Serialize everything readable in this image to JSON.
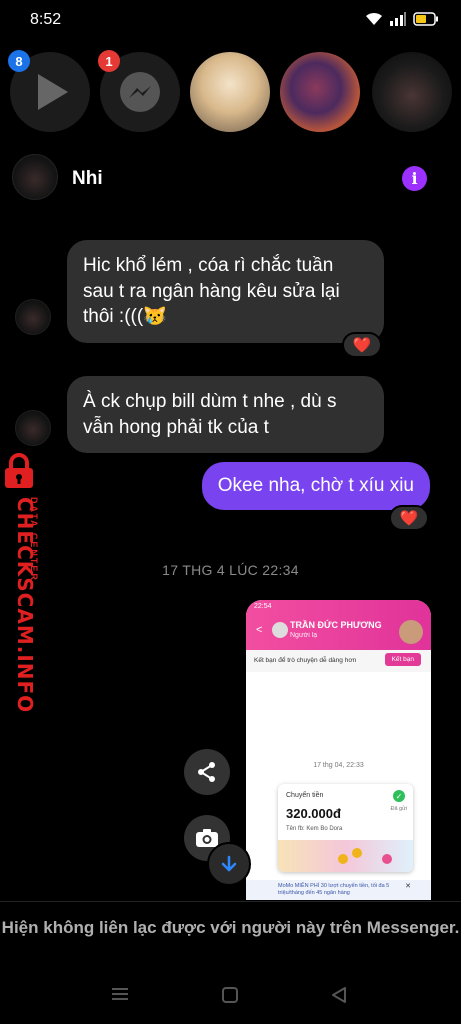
{
  "status_bar": {
    "time": "8:52"
  },
  "chat_heads": [
    {
      "name": "video-chat-head",
      "badge": "8",
      "badge_color": "#1a73e8"
    },
    {
      "name": "messenger-chat-head",
      "badge": "1",
      "badge_color": "#e53935"
    },
    {
      "name": "contact-chat-head-1"
    },
    {
      "name": "contact-chat-head-2"
    },
    {
      "name": "contact-chat-head-3"
    }
  ],
  "chat": {
    "contact_name": "Nhi",
    "info_icon": "i",
    "messages": [
      {
        "text": "Hic khổ lém , cóa rì chắc tuần sau t ra ngân hàng kêu sửa lại thôi :(((😿",
        "reaction": "❤️"
      },
      {
        "text": "À ck chụp bill dùm t nhe , dù s vẫn hong phải tk của t"
      },
      {
        "text": "Okee nha, chờ t xíu xiu",
        "reaction": "❤️"
      }
    ],
    "timestamp": "17 THG 4 LÚC 22:34",
    "shared_image": {
      "time": "22:54",
      "name": "TRẦN ĐỨC PHƯƠNG",
      "subtitle": "Người lạ",
      "strip_text": "Kết bạn để trò chuyện dễ dàng hơn",
      "strip_button": "Kết bạn",
      "date": "17 thg 04, 22:33",
      "card_title": "Chuyển tiền",
      "amount": "320.000đ",
      "account": "Tên fb: Kem Bo Dora",
      "status": "Đã gửi",
      "promo": "MoMo MIỄN PHÍ 30 lượt chuyển tiền, tối đa 5 triệu/tháng đến 45 ngân hàng"
    },
    "footer_note": "Hiện không liên lạc được với người này trên Messenger."
  },
  "watermark": {
    "main": "CHECKSCAM.INFO",
    "sub": "DATA CENTER"
  },
  "colors": {
    "accent": "#9b30ff",
    "outgoing_bubble": "#7a43f0",
    "incoming_bubble": "#303030",
    "watermark": "#e02020"
  }
}
